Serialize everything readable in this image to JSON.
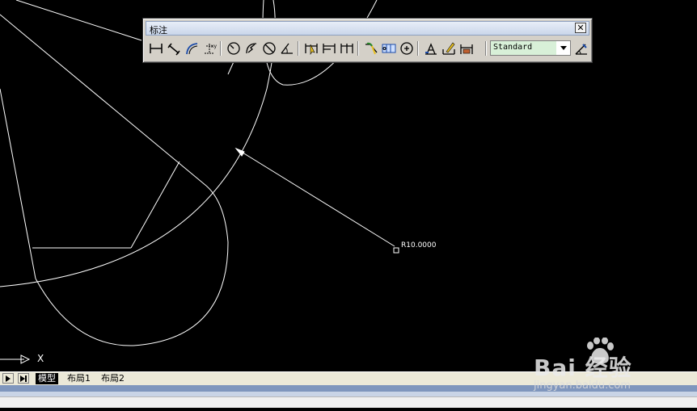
{
  "toolbar": {
    "title": "标注",
    "close_glyph": "✕",
    "dim_style": "Standard",
    "tools": [
      {
        "icon": "linear-dimension-icon"
      },
      {
        "icon": "aligned-dimension-icon"
      },
      {
        "icon": "arc-length-icon"
      },
      {
        "icon": "ordinate-dimension-icon"
      },
      {
        "icon": "radius-dimension-icon"
      },
      {
        "icon": "jogged-radius-icon"
      },
      {
        "icon": "diameter-dimension-icon"
      },
      {
        "icon": "angular-dimension-icon"
      },
      {
        "icon": "quick-dimension-icon"
      },
      {
        "icon": "baseline-dimension-icon"
      },
      {
        "icon": "continue-dimension-icon"
      },
      {
        "icon": "quick-leader-icon"
      },
      {
        "icon": "tolerance-icon"
      },
      {
        "icon": "center-mark-icon"
      },
      {
        "icon": "dimension-edit-icon"
      },
      {
        "icon": "dimension-text-edit-icon"
      },
      {
        "icon": "dimension-update-icon"
      },
      {
        "icon": "dimension-style-icon"
      }
    ]
  },
  "drawing": {
    "dimension_text": "R10.0000"
  },
  "ucs": {
    "x_label": "X"
  },
  "tabs": [
    {
      "label": "模型",
      "active": true
    },
    {
      "label": "布局1",
      "active": false
    },
    {
      "label": "布局2",
      "active": false
    }
  ],
  "watermark": {
    "main": "Bai  经验",
    "sub": "jingyan.baidu.com"
  }
}
